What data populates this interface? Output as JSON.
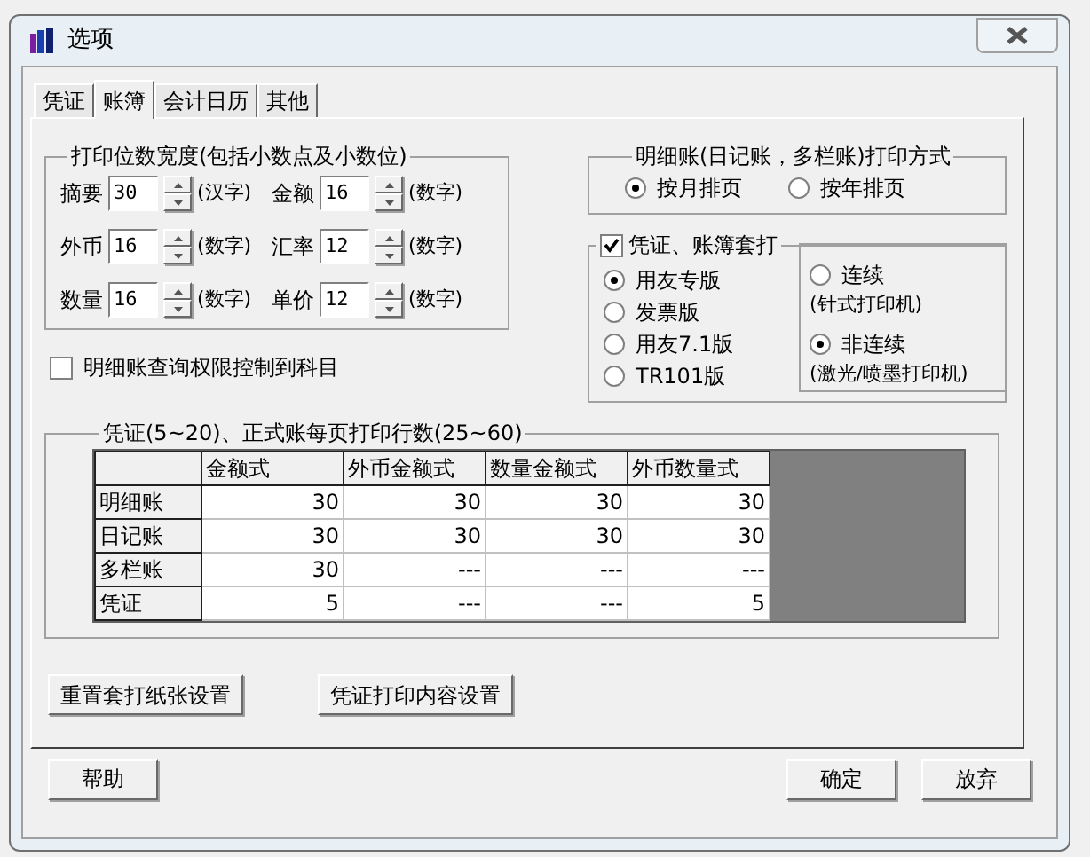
{
  "window": {
    "title": "选项"
  },
  "tabs": [
    {
      "label": "凭证",
      "selected": false
    },
    {
      "label": "账簿",
      "selected": true
    },
    {
      "label": "会计日历",
      "selected": false
    },
    {
      "label": "其他",
      "selected": false
    }
  ],
  "print_width": {
    "title": "打印位数宽度(包括小数点及小数位)",
    "fields": [
      {
        "label": "摘要",
        "value": "30",
        "unit": "(汉字)"
      },
      {
        "label": "金额",
        "value": "16",
        "unit": "(数字)"
      },
      {
        "label": "外币",
        "value": "16",
        "unit": "(数字)"
      },
      {
        "label": "汇率",
        "value": "12",
        "unit": "(数字)"
      },
      {
        "label": "数量",
        "value": "16",
        "unit": "(数字)"
      },
      {
        "label": "单价",
        "value": "12",
        "unit": "(数字)"
      }
    ]
  },
  "query_permission": {
    "label": "明细账查询权限控制到科目",
    "checked": false
  },
  "ledger_print_mode": {
    "title": "明细账(日记账，多栏账)打印方式",
    "options": [
      {
        "label": "按月排页",
        "selected": true
      },
      {
        "label": "按年排页",
        "selected": false
      }
    ]
  },
  "template_print": {
    "label": "凭证、账簿套打",
    "checked": true,
    "versions": [
      {
        "label": "用友专版",
        "selected": true
      },
      {
        "label": "发票版",
        "selected": false
      },
      {
        "label": "用友7.1版",
        "selected": false
      },
      {
        "label": "TR101版",
        "selected": false
      }
    ],
    "printers": [
      {
        "label": "连续",
        "note": "(针式打印机)",
        "selected": false
      },
      {
        "label": "非连续",
        "note": "(激光/喷墨打印机)",
        "selected": true
      }
    ]
  },
  "rows_per_page": {
    "title": "凭证(5~20)、正式账每页打印行数(25~60)",
    "columns": [
      "金额式",
      "外币金额式",
      "数量金额式",
      "外币数量式"
    ],
    "rows": [
      {
        "name": "明细账",
        "cells": [
          "30",
          "30",
          "30",
          "30"
        ]
      },
      {
        "name": "日记账",
        "cells": [
          "30",
          "30",
          "30",
          "30"
        ]
      },
      {
        "name": "多栏账",
        "cells": [
          "30",
          "---",
          "---",
          "---"
        ]
      },
      {
        "name": "凭证",
        "cells": [
          "5",
          "---",
          "---",
          "5"
        ]
      }
    ]
  },
  "page_buttons": [
    "重置套打纸张设置",
    "凭证打印内容设置"
  ],
  "footer_buttons": [
    {
      "label": "帮助",
      "kind": "left"
    },
    {
      "label": "确定",
      "kind": "right"
    },
    {
      "label": "放弃",
      "kind": "right"
    }
  ]
}
